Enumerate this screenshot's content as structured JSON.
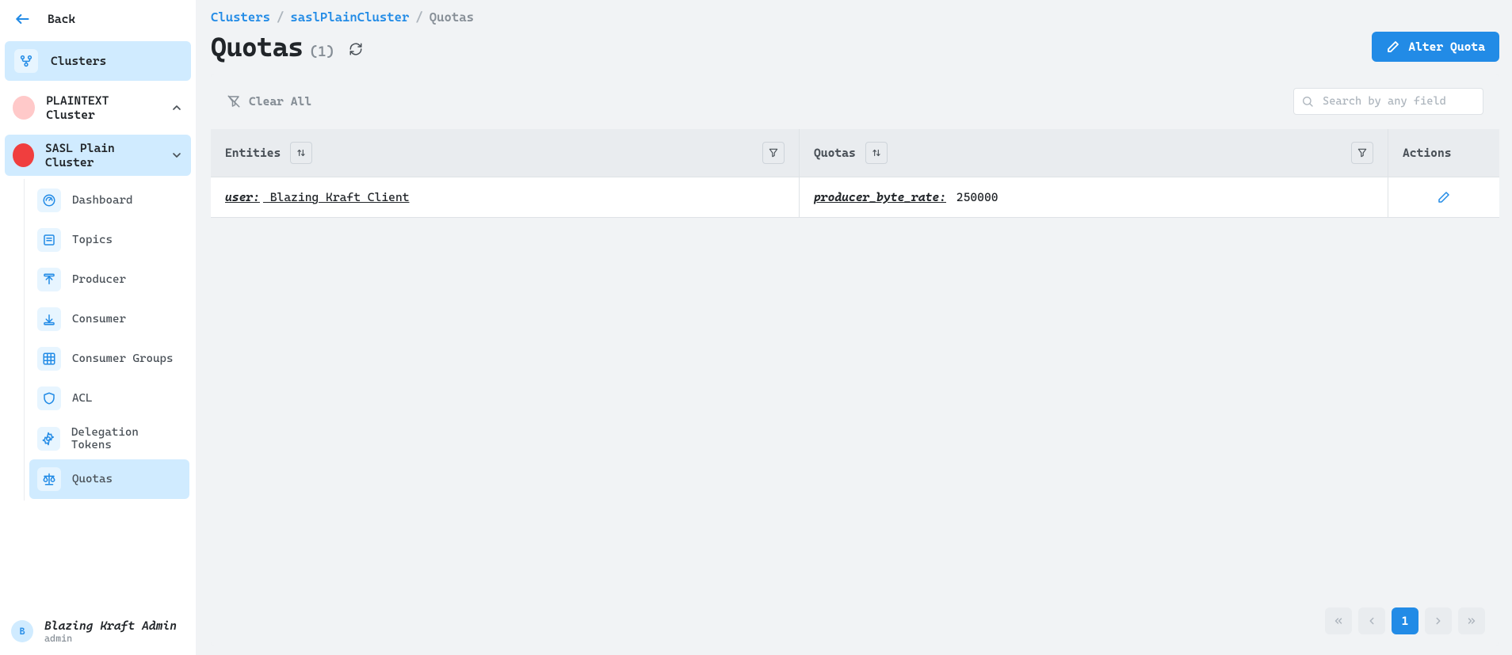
{
  "sidebar": {
    "back_label": "Back",
    "clusters_label": "Clusters",
    "cluster1": {
      "label": "PLAINTEXT Cluster",
      "expanded": false
    },
    "cluster2": {
      "label": "SASL Plain Cluster",
      "expanded": true,
      "items": [
        {
          "label": "Dashboard"
        },
        {
          "label": "Topics"
        },
        {
          "label": "Producer"
        },
        {
          "label": "Consumer"
        },
        {
          "label": "Consumer Groups"
        },
        {
          "label": "ACL"
        },
        {
          "label": "Delegation Tokens"
        },
        {
          "label": "Quotas"
        }
      ]
    },
    "user": {
      "name": "Blazing Kraft Admin",
      "role": "admin",
      "initial": "B"
    }
  },
  "breadcrumb": {
    "items": [
      "Clusters",
      "saslPlainCluster",
      "Quotas"
    ]
  },
  "header": {
    "title": "Quotas",
    "count_display": "(1)",
    "alter_button": "Alter Quota"
  },
  "toolbar": {
    "clear_all": "Clear All",
    "search_placeholder": "Search by any field"
  },
  "columns": {
    "entities": "Entities",
    "quotas": "Quotas",
    "actions": "Actions"
  },
  "rows": [
    {
      "entity_label": "user:",
      "entity_value": " Blazing Kraft Client",
      "quota_label": "producer_byte_rate:",
      "quota_value": " 250000"
    }
  ],
  "pagination": {
    "current": "1"
  }
}
